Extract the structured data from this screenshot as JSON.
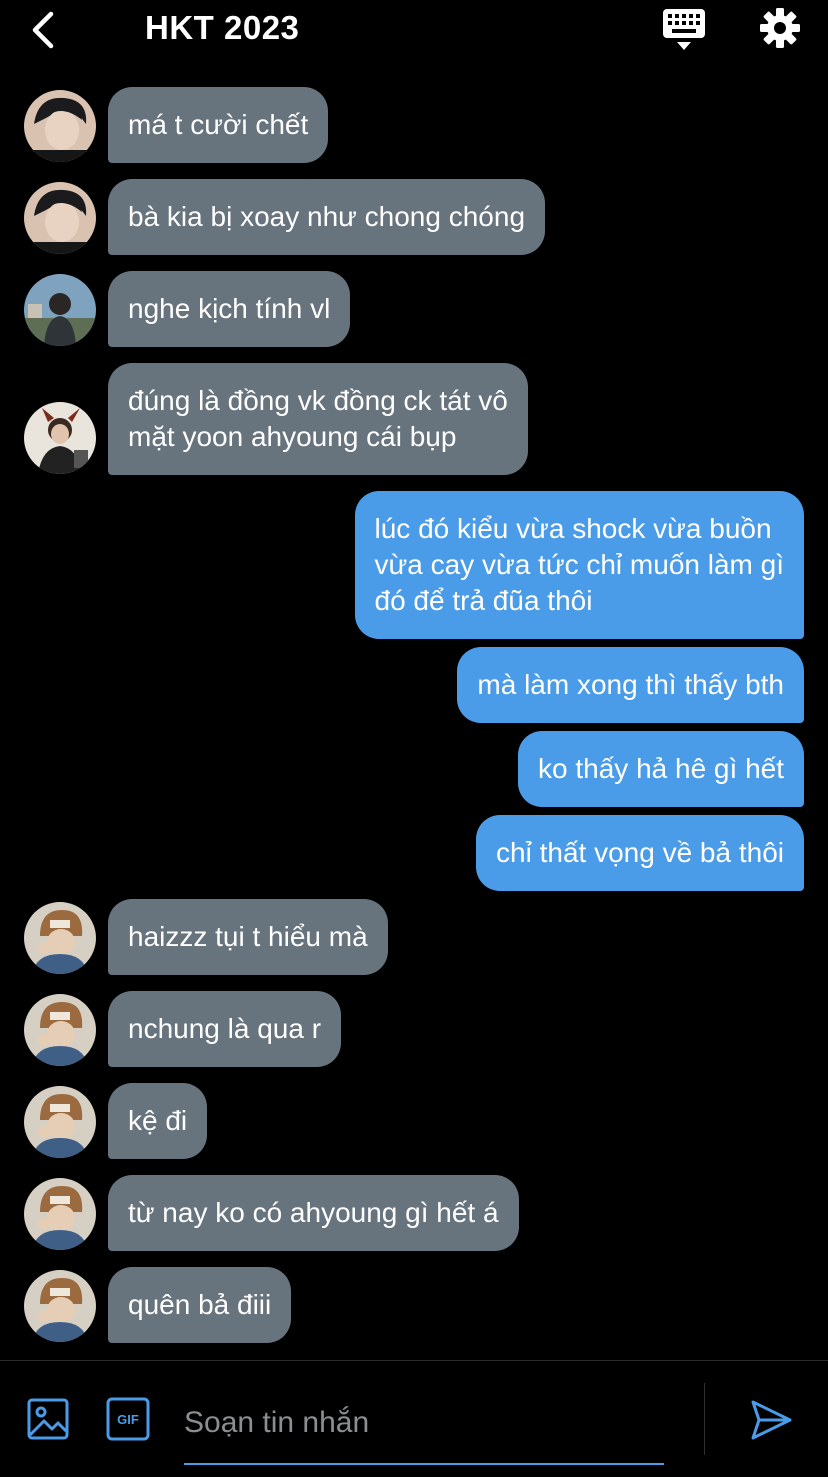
{
  "header": {
    "title": "HKT 2023",
    "back_icon": "chevron-left-icon",
    "keyboard_icon": "keyboard-icon",
    "settings_icon": "gear-icon"
  },
  "colors": {
    "background": "#000000",
    "incoming_bubble": "#67737d",
    "outgoing_bubble": "#4b9ce8",
    "accent": "#4b9ce8"
  },
  "messages": [
    {
      "text": "má t cười chết",
      "direction": "in",
      "avatar": "avatar-dark-hair"
    },
    {
      "text": "bà kia bị xoay như chong chóng",
      "direction": "in",
      "avatar": "avatar-dark-hair"
    },
    {
      "text": "nghe kịch tính vl",
      "direction": "in",
      "avatar": "avatar-outdoor"
    },
    {
      "text": "đúng là đồng vk đồng ck tát vô\nmặt yoon ahyoung cái bụp",
      "direction": "in",
      "avatar": "avatar-horns"
    },
    {
      "text": "lúc đó kiểu vừa shock vừa buồn\nvừa cay vừa tức chỉ muốn làm gì\nđó để trả đũa thôi",
      "direction": "out"
    },
    {
      "text": "mà làm xong thì thấy bth",
      "direction": "out"
    },
    {
      "text": "ko thấy hả hê gì hết",
      "direction": "out"
    },
    {
      "text": "chỉ thất vọng về bả thôi",
      "direction": "out"
    },
    {
      "text": "haizzz tụi t hiểu mà",
      "direction": "in",
      "avatar": "avatar-beanie"
    },
    {
      "text": "nchung là qua r",
      "direction": "in",
      "avatar": "avatar-beanie"
    },
    {
      "text": "kệ đi",
      "direction": "in",
      "avatar": "avatar-beanie"
    },
    {
      "text": "từ nay ko có ahyoung gì hết á",
      "direction": "in",
      "avatar": "avatar-beanie"
    },
    {
      "text": "quên bả điii",
      "direction": "in",
      "avatar": "avatar-beanie"
    }
  ],
  "composer": {
    "placeholder": "Soạn tin nhắn",
    "image_icon": "image-icon",
    "gif_label": "GIF",
    "send_icon": "send-icon"
  }
}
